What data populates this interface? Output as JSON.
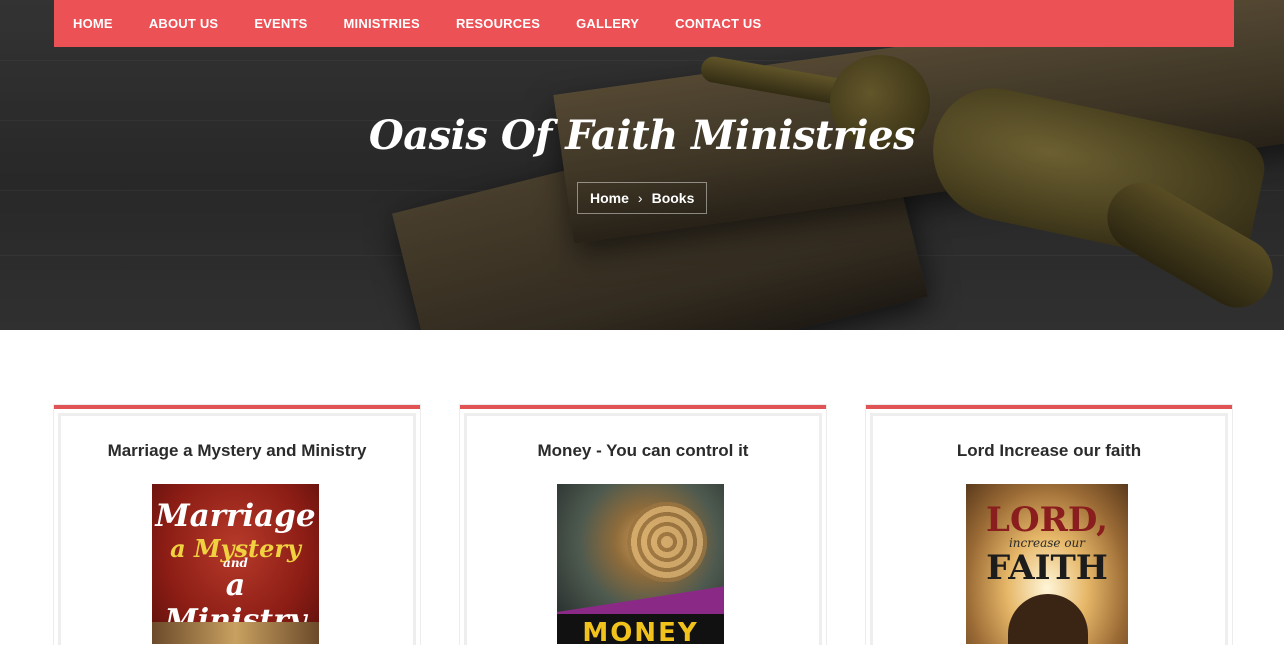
{
  "nav": {
    "items": [
      "HOME",
      "ABOUT US",
      "EVENTS",
      "MINISTRIES",
      "RESOURCES",
      "GALLERY",
      "CONTACT US"
    ]
  },
  "hero": {
    "title": "Oasis Of Faith Ministries",
    "breadcrumb": {
      "home": "Home",
      "separator": "›",
      "current": "Books"
    }
  },
  "books": [
    {
      "title": "Marriage a Mystery and Ministry",
      "cover_text": [
        "Marriage",
        "a Mystery",
        "and",
        "a Ministry"
      ]
    },
    {
      "title": "Money - You can control it",
      "cover_text": [
        "MONEY"
      ]
    },
    {
      "title": "Lord Increase our faith",
      "cover_text": [
        "LORD,",
        "increase our",
        "FAITH"
      ]
    }
  ],
  "colors": {
    "accent": "#ec5156",
    "card_border": "#e05456",
    "text_dark": "#2b2b2b"
  }
}
